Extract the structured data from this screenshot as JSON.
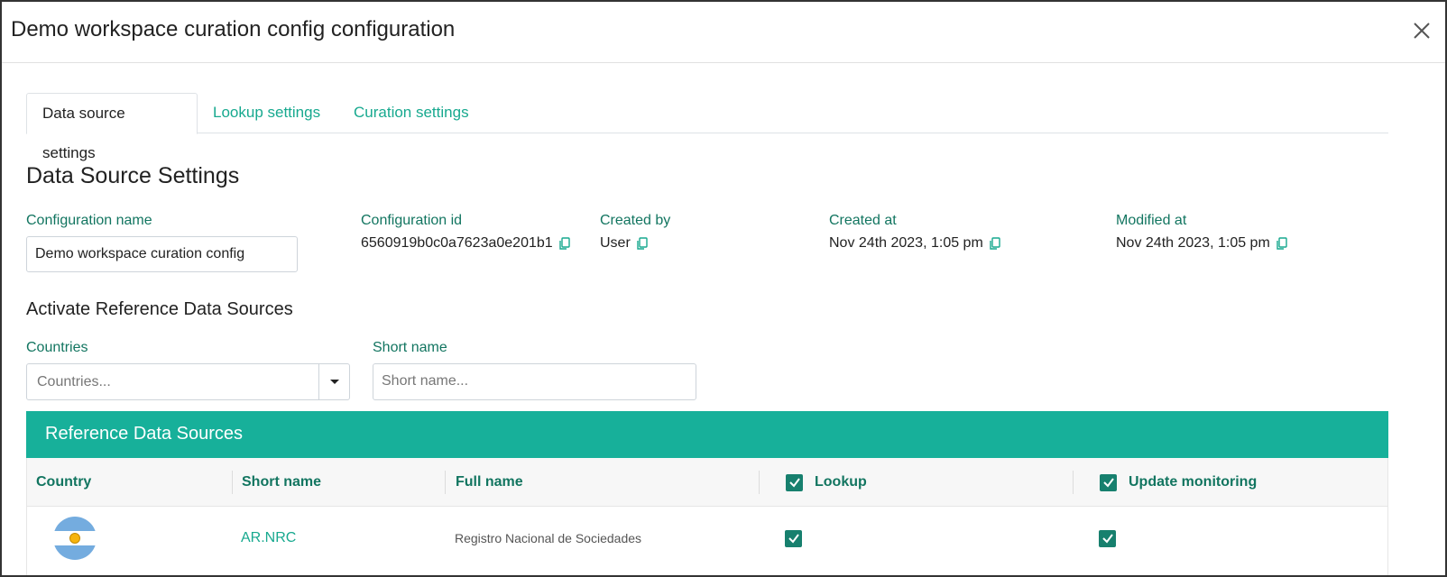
{
  "modal": {
    "title": "Demo workspace curation config configuration"
  },
  "tabs": [
    {
      "label": "Data source settings",
      "active": true
    },
    {
      "label": "Lookup settings",
      "active": false
    },
    {
      "label": "Curation settings",
      "active": false
    }
  ],
  "data_source": {
    "section_title": "Data Source Settings",
    "configuration_name": {
      "label": "Configuration name",
      "value": "Demo workspace curation config"
    },
    "configuration_id": {
      "label": "Configuration id",
      "value": "6560919b0c0a7623a0e201b1"
    },
    "created_by": {
      "label": "Created by",
      "value": "User"
    },
    "created_at": {
      "label": "Created at",
      "value": "Nov 24th 2023, 1:05 pm"
    },
    "modified_at": {
      "label": "Modified at",
      "value": "Nov 24th 2023, 1:05 pm"
    }
  },
  "activate": {
    "title": "Activate Reference Data Sources",
    "countries": {
      "label": "Countries",
      "placeholder": "Countries..."
    },
    "short_name": {
      "label": "Short name",
      "placeholder": "Short name..."
    }
  },
  "reference_table": {
    "panel_title": "Reference Data Sources",
    "columns": {
      "country": "Country",
      "short_name": "Short name",
      "full_name": "Full name",
      "lookup": "Lookup",
      "update_monitoring": "Update monitoring"
    },
    "rows": [
      {
        "country_flag": "argentina-flag-icon",
        "short_name": "AR.NRC",
        "full_name": "Registro Nacional de Sociedades",
        "lookup": true,
        "update_monitoring": true
      }
    ]
  },
  "colors": {
    "accent": "#17b09a",
    "label_green": "#127560",
    "checkbox_green": "#17806e"
  }
}
